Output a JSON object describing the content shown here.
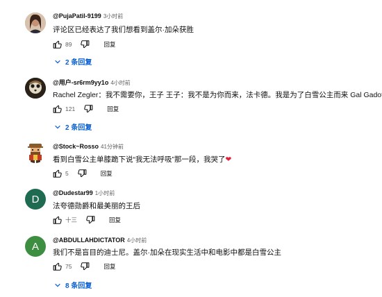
{
  "comments": [
    {
      "author": "@PujaPatil-9199",
      "time": "3小时前",
      "text": "评论区已经表达了我们想看到盖尔·加朵获胜",
      "likes": "89",
      "reply_label": "回复",
      "replies_label": "2 条回复",
      "avatar": {
        "type": "photo",
        "bg": "#caa98c"
      }
    },
    {
      "author": "@用户-sr6rm9yy1o",
      "time": "4小时前",
      "text": "Rachel Zegler：我不需要你，王子 王子：我不是为你而来，法卡德。我是为了白雪公主而来 Gal Gadot",
      "likes": "121",
      "reply_label": "回复",
      "replies_label": "2 条回复",
      "avatar": {
        "type": "photo",
        "bg": "#3b3022"
      }
    },
    {
      "author": "@Stock~Rosso",
      "time": "41分钟前",
      "text": "看到白雪公主单膝跪下说“我无法呼吸”那一段，我哭了",
      "emoji": "❤",
      "likes": "5",
      "reply_label": "回复",
      "avatar": {
        "type": "pixel",
        "bg": "#ffffff"
      }
    },
    {
      "author": "@Dudestar99",
      "time": "1小时前",
      "text": "法夸德勋爵和最美丽的王后",
      "likes": "十三",
      "reply_label": "回复",
      "avatar": {
        "type": "letter",
        "letter": "D",
        "bg": "#1f6b52"
      }
    },
    {
      "author": "@ABDULLAHDICTATOR",
      "time": "4小时前",
      "text": "我们不是盲目的迪士尼。盖尔·加朵在现实生活中和电影中都是白雪公主",
      "likes": "75",
      "reply_label": "回复",
      "replies_label": "8 条回复",
      "avatar": {
        "type": "letter",
        "letter": "A",
        "bg": "#3e8e41"
      }
    }
  ]
}
